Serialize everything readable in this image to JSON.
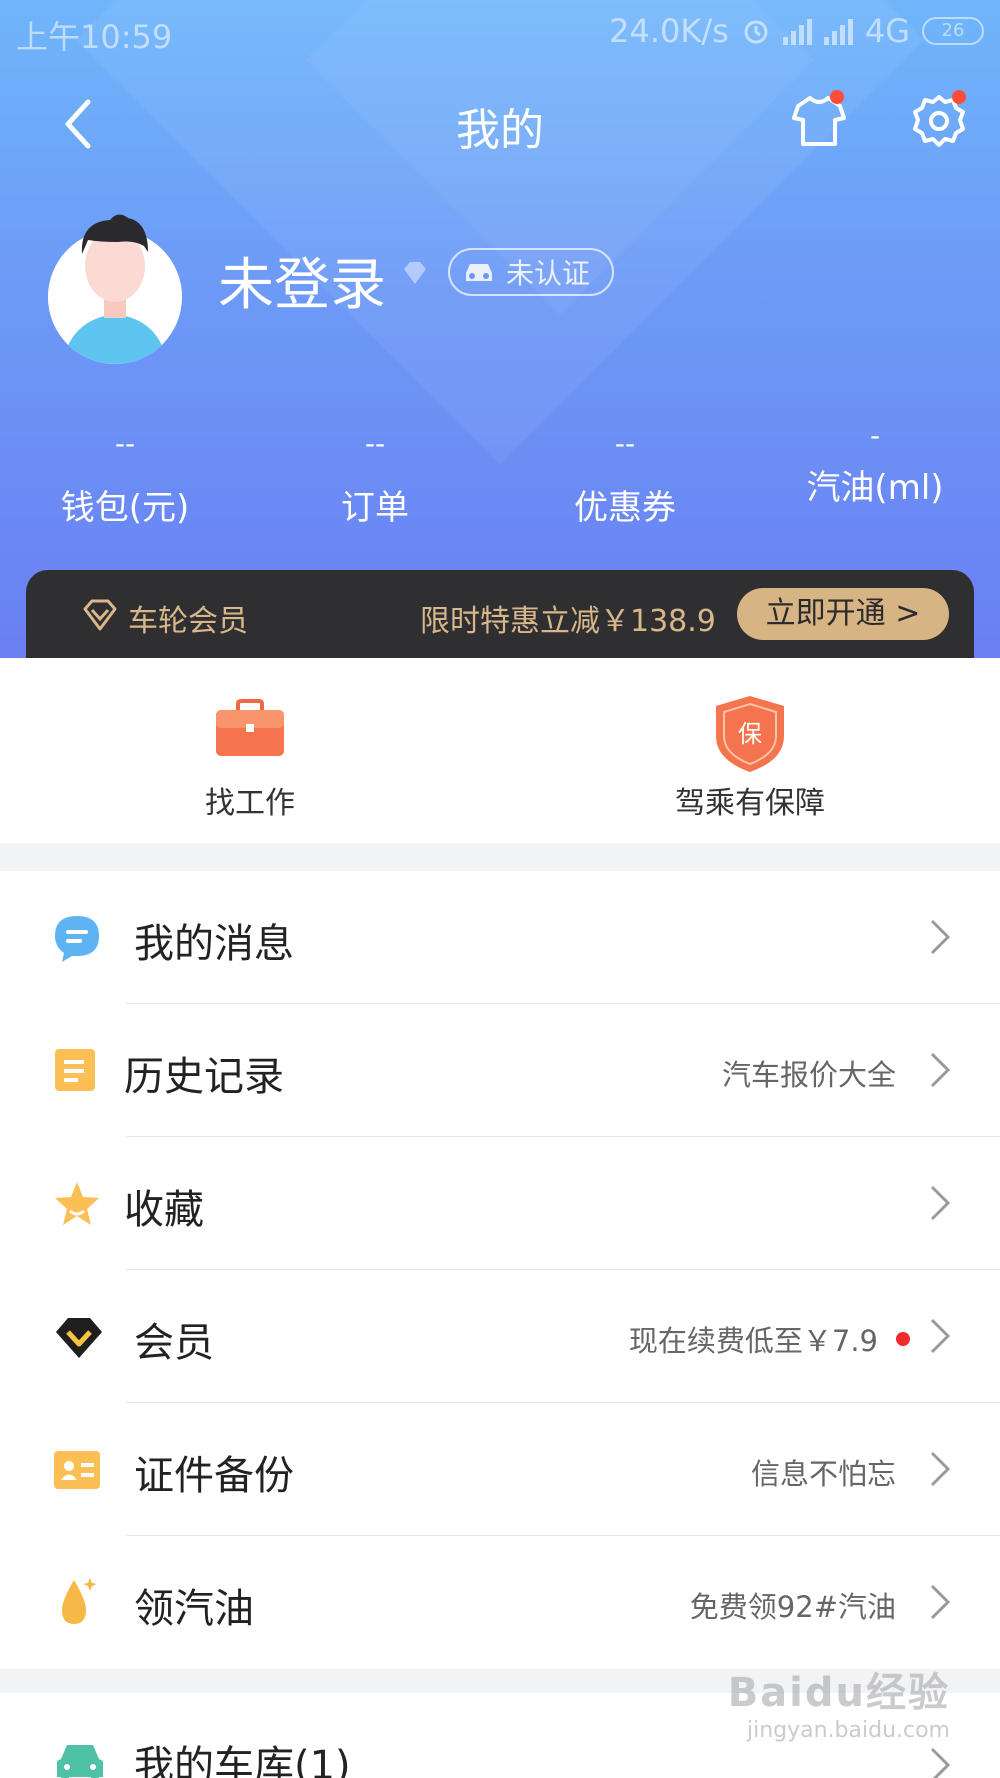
{
  "status_bar": {
    "time": "上午10:59",
    "net_speed": "24.0K/s",
    "network": "4G",
    "battery": "26"
  },
  "nav": {
    "title": "我的"
  },
  "profile": {
    "name": "未登录",
    "auth_label": "未认证"
  },
  "stats": [
    {
      "value": "--",
      "label": "钱包(元)"
    },
    {
      "value": "--",
      "label": "订单"
    },
    {
      "value": "--",
      "label": "优惠券"
    },
    {
      "value": "-",
      "label": "汽油(ml)"
    }
  ],
  "membership_bar": {
    "label": "车轮会员",
    "promo": "限时特惠立减￥138.9",
    "button": "立即开通 >"
  },
  "quick_services": [
    {
      "label": "找工作",
      "icon": "briefcase-icon"
    },
    {
      "label": "驾乘有保障",
      "icon": "insurance-shield-icon",
      "badge": "保"
    }
  ],
  "menu": [
    {
      "label": "我的消息",
      "sub": "",
      "icon": "message-icon"
    },
    {
      "label": "历史记录",
      "sub": "汽车报价大全",
      "icon": "history-icon"
    },
    {
      "label": "收藏",
      "sub": "",
      "icon": "star-icon"
    },
    {
      "label": "会员",
      "sub": "现在续费低至￥7.9",
      "icon": "vip-diamond-icon",
      "dot": true
    },
    {
      "label": "证件备份",
      "sub": "信息不怕忘",
      "icon": "id-card-icon"
    },
    {
      "label": "领汽油",
      "sub": "免费领92#汽油",
      "icon": "oil-drop-icon"
    }
  ],
  "garage": {
    "label": "我的车库(1)",
    "icon": "car-icon"
  },
  "watermark": {
    "brand": "Baidu经验",
    "url": "jingyan.baidu.com"
  },
  "colors": {
    "header_top": "#6fb6fb",
    "header_bottom": "#6a7ff2",
    "gold": "#d6b484",
    "dark": "#2f2e31",
    "red_dot": "#ef2b2b"
  }
}
